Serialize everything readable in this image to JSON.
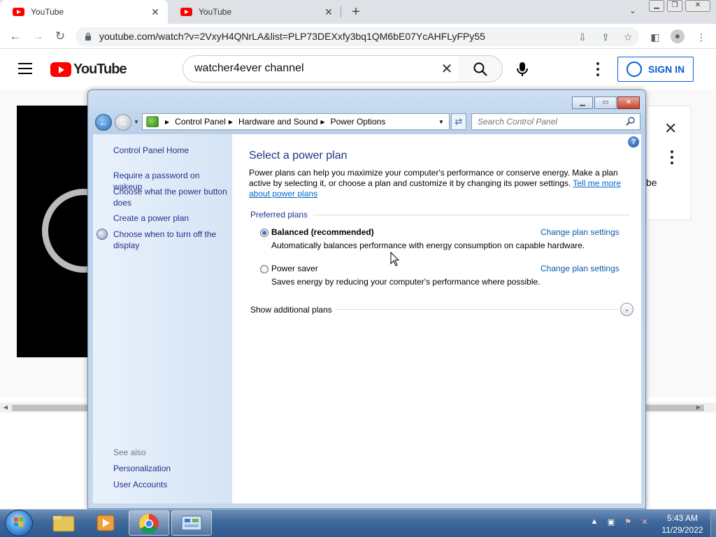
{
  "browser": {
    "tabs": [
      {
        "title": "YouTube",
        "active": true
      },
      {
        "title": "YouTube",
        "active": false
      }
    ],
    "url": "youtube.com/watch?v=2VxyH4QNrLA&list=PLP73DEXxfy3bq1QM6bE07YcAHFLyFPy55"
  },
  "youtube": {
    "logo_text": "YouTube",
    "search_value": "watcher4ever channel",
    "sign_in_label": "SIGN IN",
    "side_panel_partial_text": "be"
  },
  "window": {
    "breadcrumbs": [
      "Control Panel",
      "Hardware and Sound",
      "Power Options"
    ],
    "search_placeholder": "Search Control Panel",
    "left_pane": {
      "home": "Control Panel Home",
      "links": [
        "Require a password on wakeup",
        "Choose what the power button does",
        "Create a power plan",
        "Choose when to turn off the display"
      ],
      "see_also_label": "See also",
      "see_also": [
        "Personalization",
        "User Accounts"
      ]
    },
    "main": {
      "title": "Select a power plan",
      "description": "Power plans can help you maximize your computer's performance or conserve energy. Make a plan active by selecting it, or choose a plan and customize it by changing its power settings.",
      "tell_me_more": "Tell me more about power plans",
      "preferred_label": "Preferred plans",
      "plans": [
        {
          "name": "Balanced (recommended)",
          "description": "Automatically balances performance with energy consumption on capable hardware.",
          "selected": true,
          "action": "Change plan settings"
        },
        {
          "name": "Power saver",
          "description": "Saves energy by reducing your computer's performance where possible.",
          "selected": false,
          "action": "Change plan settings"
        }
      ],
      "show_additional": "Show additional plans"
    }
  },
  "taskbar": {
    "time": "5:43 AM",
    "date": "11/29/2022"
  },
  "colors": {
    "link_blue": "#1e3287",
    "yt_red": "#ff0000",
    "signin_blue": "#065fd4"
  }
}
